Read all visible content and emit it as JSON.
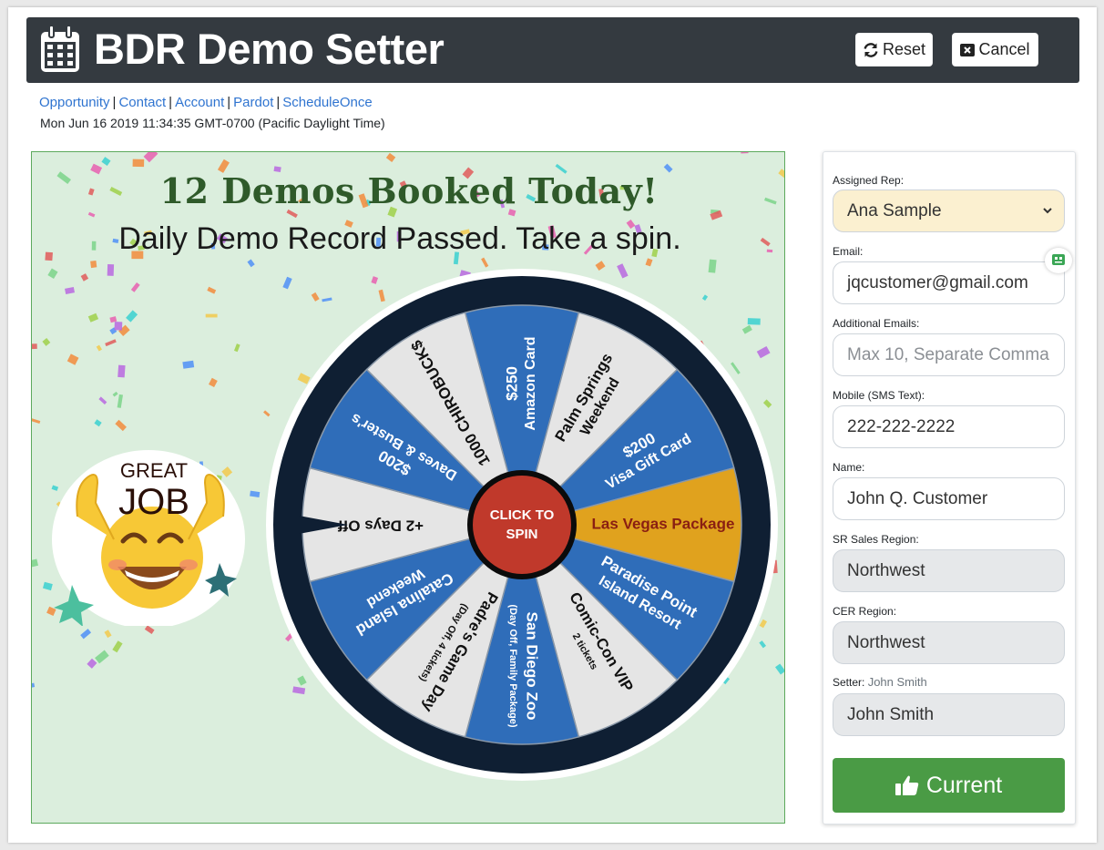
{
  "app": {
    "title": "BDR Demo Setter",
    "reset_label": "Reset",
    "cancel_label": "Cancel"
  },
  "links": [
    "Opportunity",
    "Contact",
    "Account",
    "Pardot",
    "ScheduleOnce"
  ],
  "datetime": "Mon Jun 16 2019 11:34:35 GMT-0700 (Pacific Daylight Time)",
  "celebration": {
    "headline": "12 Demos Booked Today!",
    "subline": "Daily Demo Record Passed. Take a spin.",
    "badge_line1": "GREAT",
    "badge_line2": "JOB"
  },
  "wheel": {
    "center_line1": "CLICK TO",
    "center_line2": "SPIN",
    "segments": [
      {
        "line1": "$250",
        "line2": "Amazon Card",
        "fill": "#2f6db9"
      },
      {
        "line1": "Palm Springs",
        "line2": "Weekend",
        "fill": "#e5e5e5"
      },
      {
        "line1": "$200",
        "line2": "Visa Gift Card",
        "fill": "#2f6db9"
      },
      {
        "line1": "Las Vegas Package",
        "line2": "",
        "fill": "#e0a21e"
      },
      {
        "line1": "Paradise Point",
        "line2": "Island Resort",
        "fill": "#2f6db9"
      },
      {
        "line1": "Comic-Con VIP",
        "line2": "2 tickets",
        "fill": "#e5e5e5"
      },
      {
        "line1": "San Diego Zoo",
        "line2": "(Day Off, Family Package)",
        "fill": "#2f6db9"
      },
      {
        "line1": "Padre's Game Day",
        "line2": "(Day Off, 4 tickets)",
        "fill": "#e5e5e5"
      },
      {
        "line1": "Catalina Island",
        "line2": "Weekend",
        "fill": "#2f6db9"
      },
      {
        "line1": "+2 Days Off",
        "line2": "",
        "fill": "#e5e5e5"
      },
      {
        "line1": "$200",
        "line2": "Daves & Buster's",
        "fill": "#2f6db9"
      },
      {
        "line1": "1000 CHIROBUCK$",
        "line2": "",
        "fill": "#e5e5e5"
      }
    ]
  },
  "form": {
    "assigned_rep_label": "Assigned Rep:",
    "assigned_rep_value": "Ana Sample",
    "email_label": "Email:",
    "email_value": "jqcustomer@gmail.com",
    "additional_emails_label": "Additional Emails:",
    "additional_emails_placeholder": "Max 10, Separate  Comma",
    "mobile_label": "Mobile (SMS Text):",
    "mobile_value": "222-222-2222",
    "name_label": "Name:",
    "name_value": "John Q. Customer",
    "sr_region_label": "SR Sales Region:",
    "sr_region_value": "Northwest",
    "cer_region_label": "CER Region:",
    "cer_region_value": "Northwest",
    "setter_label": "Setter:",
    "setter_label_value": "John Smith",
    "setter_value": "John Smith",
    "current_button": "Current"
  },
  "colors": {
    "header_bg": "#343a40",
    "link": "#2f74d0",
    "panel_bg": "#dbeedd",
    "wheel_rim": "#0f1f33",
    "wheel_center": "#c0392b",
    "success": "#4a9b45",
    "select_bg": "#fbf0d0",
    "readonly_bg": "#e6e8ea"
  },
  "icons": {
    "header": "calendar-icon",
    "reset": "refresh-icon",
    "cancel": "close-box-icon",
    "select": "chevron-down-icon",
    "assistant": "robot-icon",
    "current": "thumbs-up-icon"
  }
}
